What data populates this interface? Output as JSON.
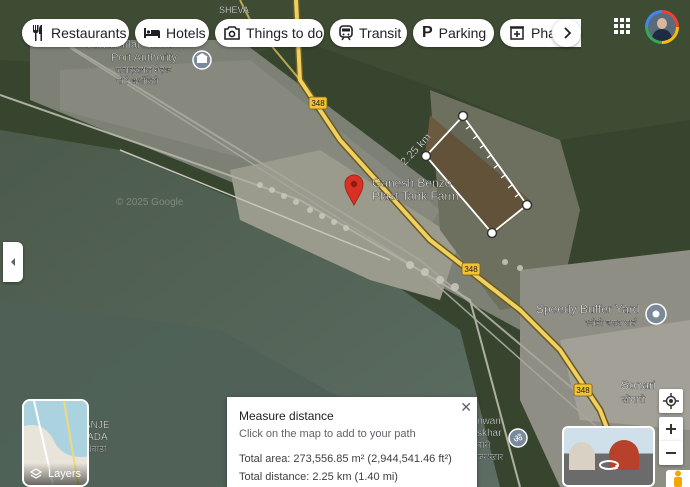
{
  "chips": [
    {
      "label": "Restaurants",
      "icon": "fork-knife-icon"
    },
    {
      "label": "Hotels",
      "icon": "bed-icon"
    },
    {
      "label": "Things to do",
      "icon": "camera-icon"
    },
    {
      "label": "Transit",
      "icon": "train-icon"
    },
    {
      "label": "Parking",
      "icon": "parking-icon"
    },
    {
      "label": "Pharmacies",
      "icon": "pharmacy-icon"
    }
  ],
  "map": {
    "places": {
      "sheva": "SHEVA",
      "port_authority_en_1": "Jawaharlal Nehru",
      "port_authority_en_2": "Port Authority",
      "port_authority_hi_1": "जवाहरलाल नेहरू",
      "port_authority_hi_2": "पोर्ट अथॉरिटी",
      "tank_farm_1": "Ganesh Benzo",
      "tank_farm_2": "Plast Tank Farm",
      "buffer_yard_en": "Speedy Buffer Yard",
      "buffer_yard_hi": "स्पीडी बफ़र यार्ड",
      "sonari_en": "Sonari",
      "sonari_hi": "सोनारी",
      "panje_1": "PANJE",
      "panje_2": "WADA",
      "panje_hi": "ेलीवाडा",
      "jaswari_1": "nwari",
      "jaswari_2": "skhar",
      "jaswari_hi_1": "वारी",
      "jaswari_hi_2": "जसखार",
      "copyright": "© 2025 Google"
    },
    "highway_badge": "348",
    "segment_distance": "2.25 km",
    "accent": "#d93025",
    "road_color": "#f0d060"
  },
  "measure": {
    "title": "Measure distance",
    "hint": "Click on the map to add to your path",
    "total_area": "Total area: 273,556.85 m² (2,944,541.46 ft²)",
    "total_distance": "Total distance: 2.25 km (1.40 mi)"
  },
  "layers": {
    "label": "Layers"
  }
}
